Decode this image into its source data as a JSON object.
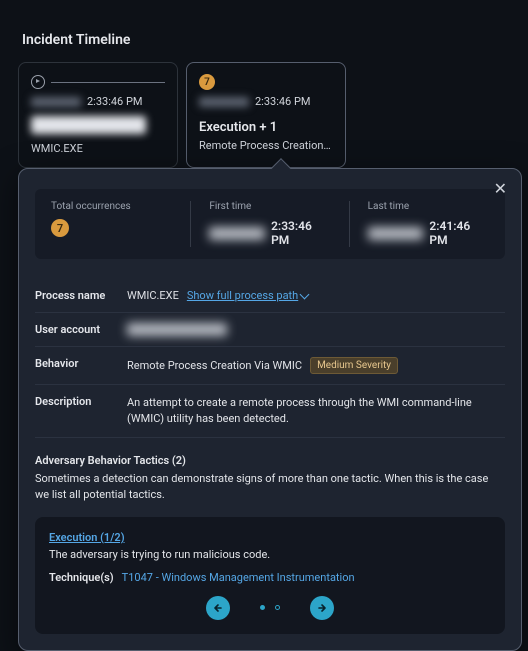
{
  "section_title": "Incident Timeline",
  "cards": [
    {
      "time": "2:33:46 PM",
      "sub": "WMIC.EXE"
    },
    {
      "count": "7",
      "time": "2:33:46 PM",
      "title": "Execution + 1",
      "sub": "Remote Process Creation …"
    }
  ],
  "popover": {
    "occurrences": {
      "label": "Total occurrences",
      "value": "7"
    },
    "first": {
      "label": "First time",
      "time": "2:33:46 PM"
    },
    "last": {
      "label": "Last time",
      "time": "2:41:46 PM"
    },
    "process_name": {
      "label": "Process name",
      "value": "WMIC.EXE",
      "link": "Show full process path"
    },
    "user_account": {
      "label": "User account"
    },
    "behavior": {
      "label": "Behavior",
      "value": "Remote Process Creation Via WMIC",
      "severity": "Medium Severity"
    },
    "description": {
      "label": "Description",
      "value": "An attempt to create a remote process through the WMI command-line (WMIC) utility has been detected."
    },
    "tactics": {
      "heading": "Adversary Behavior Tactics (2)",
      "body": "Sometimes a detection can demonstrate signs of more than one tactic. When this is the case we list all potential tactics.",
      "card": {
        "title": "Execution (1/2)",
        "desc": "The adversary is trying to run malicious code.",
        "technique_label": "Technique(s)",
        "technique": "T1047 - Windows Management Instrumentation"
      }
    }
  }
}
